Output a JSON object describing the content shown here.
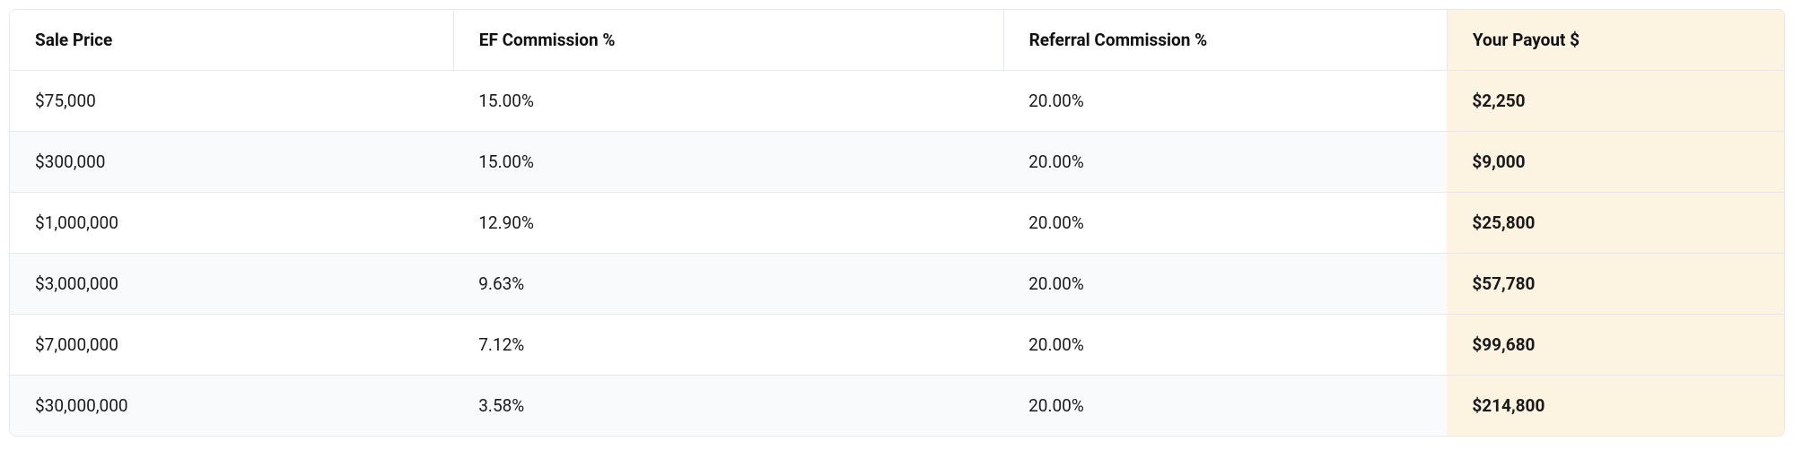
{
  "table": {
    "headers": {
      "sale_price": "Sale Price",
      "ef_commission": "EF Commission %",
      "referral_commission": "Referral Commission %",
      "payout": "Your Payout $"
    },
    "rows": [
      {
        "sale_price": "$75,000",
        "ef_commission": "15.00%",
        "referral_commission": "20.00%",
        "payout": "$2,250"
      },
      {
        "sale_price": "$300,000",
        "ef_commission": "15.00%",
        "referral_commission": "20.00%",
        "payout": "$9,000"
      },
      {
        "sale_price": "$1,000,000",
        "ef_commission": "12.90%",
        "referral_commission": "20.00%",
        "payout": "$25,800"
      },
      {
        "sale_price": "$3,000,000",
        "ef_commission": "9.63%",
        "referral_commission": "20.00%",
        "payout": "$57,780"
      },
      {
        "sale_price": "$7,000,000",
        "ef_commission": "7.12%",
        "referral_commission": "20.00%",
        "payout": "$99,680"
      },
      {
        "sale_price": "$30,000,000",
        "ef_commission": "3.58%",
        "referral_commission": "20.00%",
        "payout": "$214,800"
      }
    ]
  }
}
